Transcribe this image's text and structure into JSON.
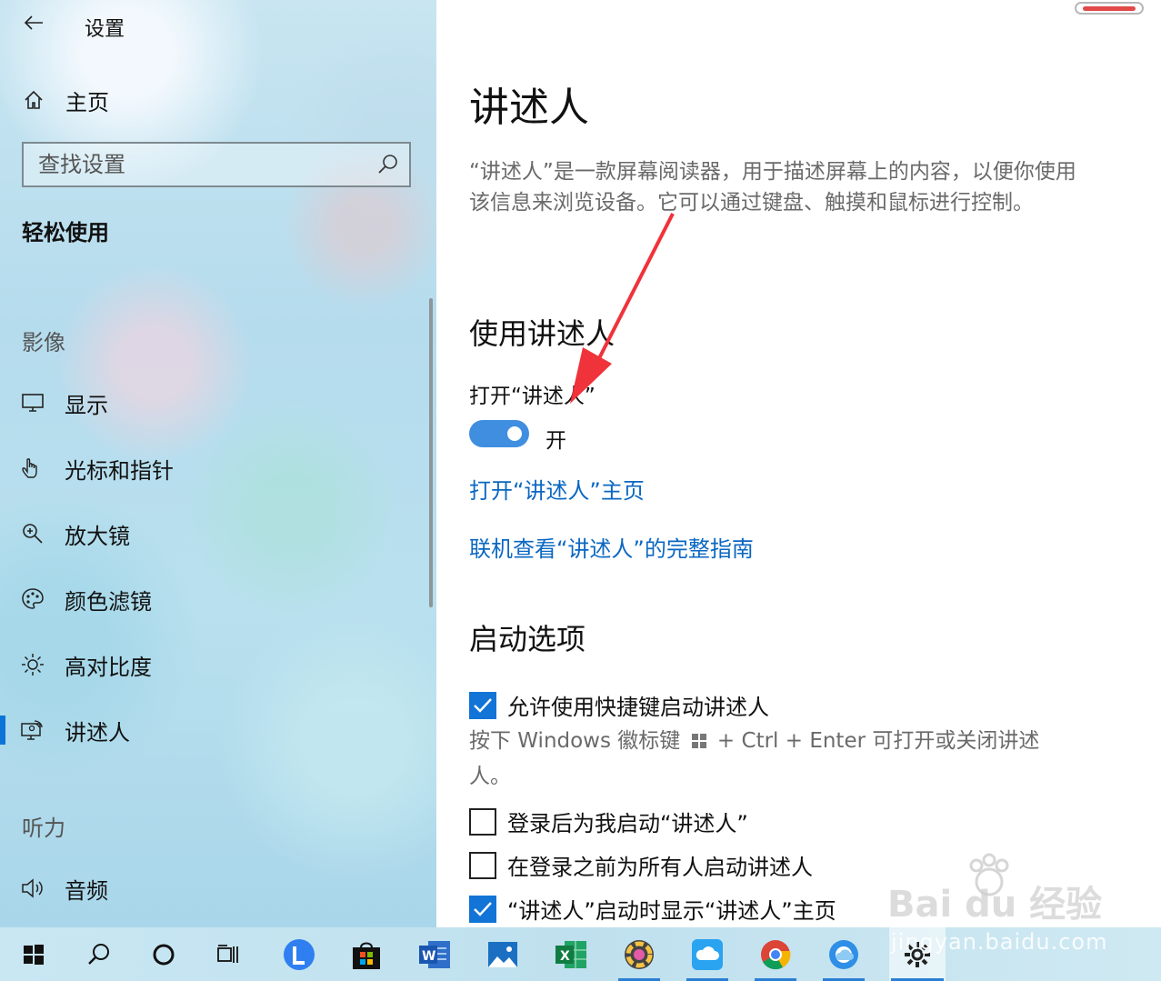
{
  "window": {
    "title": "设置"
  },
  "sidebar": {
    "home_label": "主页",
    "search_placeholder": "查找设置",
    "section": "轻松使用",
    "groups": [
      {
        "label": "影像"
      },
      {
        "label": "听力"
      }
    ],
    "items": [
      {
        "label": "显示",
        "icon": "monitor-icon"
      },
      {
        "label": "光标和指针",
        "icon": "pointer-icon"
      },
      {
        "label": "放大镜",
        "icon": "magnifier-icon"
      },
      {
        "label": "颜色滤镜",
        "icon": "palette-icon"
      },
      {
        "label": "高对比度",
        "icon": "brightness-icon"
      },
      {
        "label": "讲述人",
        "icon": "narrator-icon",
        "active": true
      },
      {
        "label": "音频",
        "icon": "speaker-icon"
      }
    ]
  },
  "main": {
    "title": "讲述人",
    "description": "“讲述人”是一款屏幕阅读器，用于描述屏幕上的内容，以便你使用该信息来浏览设备。它可以通过键盘、触摸和鼠标进行控制。",
    "use_section": {
      "title": "使用讲述人",
      "toggle_label": "打开“讲述人”",
      "toggle_state": "开",
      "toggle_on": true,
      "link_home": "打开“讲述人”主页",
      "link_guide": "联机查看“讲述人”的完整指南"
    },
    "startup_section": {
      "title": "启动选项",
      "options": [
        {
          "label": "允许使用快捷键启动讲述人",
          "checked": true
        },
        {
          "label": "登录后为我启动“讲述人”",
          "checked": false
        },
        {
          "label": "在登录之前为所有人启动讲述人",
          "checked": false
        },
        {
          "label": "“讲述人”启动时显示“讲述人”主页",
          "checked": true
        }
      ],
      "hint_prefix": "按下 Windows 徽标键",
      "hint_suffix": "+ Ctrl + Enter 可打开或关闭讲述",
      "hint_line2": "人。"
    }
  },
  "accent_color": "#0b74d6",
  "link_color": "#0b67c2",
  "taskbar": {
    "icons": [
      "start-icon",
      "search-icon",
      "cortana-icon",
      "task-view-icon",
      "lenovo-icon",
      "store-icon",
      "word-icon",
      "photos-icon",
      "excel-icon",
      "color-app-icon",
      "cloud-app-icon",
      "chrome-icon",
      "edge-icon",
      "settings-icon"
    ]
  },
  "watermark": {
    "brand": "Bai du 经验",
    "url": "jingyan.baidu.com"
  }
}
